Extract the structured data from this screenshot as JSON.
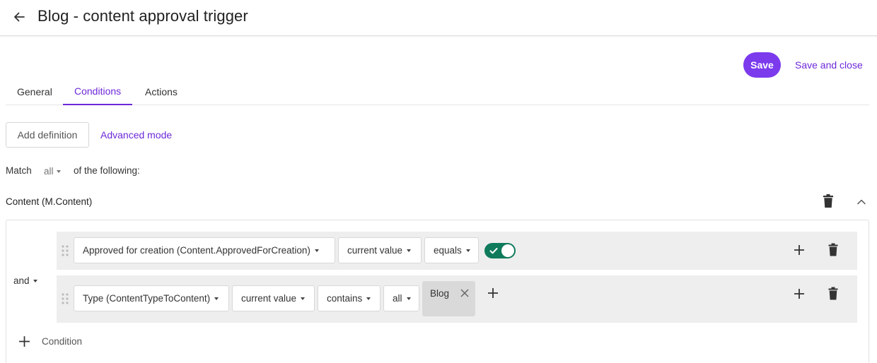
{
  "header": {
    "title": "Blog - content approval trigger",
    "back_icon": "arrow-left"
  },
  "actions": {
    "save_label": "Save",
    "save_close_label": "Save and close",
    "accent_color": "#7c3aed"
  },
  "tabs": [
    {
      "label": "General",
      "active": false
    },
    {
      "label": "Conditions",
      "active": true
    },
    {
      "label": "Actions",
      "active": false
    }
  ],
  "toolbar": {
    "add_definition_label": "Add definition",
    "advanced_mode_label": "Advanced mode"
  },
  "match": {
    "prefix": "Match",
    "value": "all",
    "suffix": "of the following:"
  },
  "section": {
    "title": "Content (M.Content)",
    "expanded": true
  },
  "logic": {
    "operator": "and"
  },
  "conditions": [
    {
      "field": "Approved for creation (Content.ApprovedForCreation)",
      "value_type": "current value",
      "operator": "equals",
      "toggle_on": true,
      "toggle_color": "#0f7a5c"
    },
    {
      "field": "Type (ContentTypeToContent)",
      "value_type": "current value",
      "operator": "contains",
      "quantifier": "all",
      "tags": [
        "Blog"
      ]
    }
  ],
  "add_condition_label": "Condition"
}
